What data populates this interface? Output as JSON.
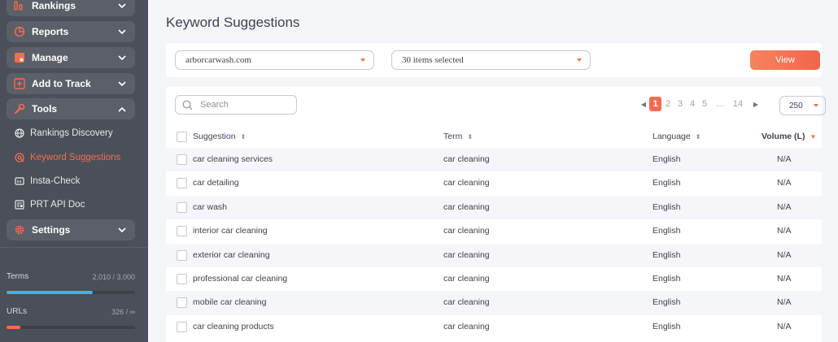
{
  "sidebar": {
    "nav": [
      {
        "label": "Rankings",
        "icon": "bar-chart-icon",
        "expanded": false
      },
      {
        "label": "Reports",
        "icon": "pie-chart-icon",
        "expanded": false
      },
      {
        "label": "Manage",
        "icon": "edit-icon",
        "expanded": false
      },
      {
        "label": "Add to Track",
        "icon": "plus-square-icon",
        "expanded": false
      },
      {
        "label": "Tools",
        "icon": "tools-icon",
        "expanded": true
      },
      {
        "label": "Settings",
        "icon": "gear-icon",
        "expanded": false
      }
    ],
    "tools_items": [
      {
        "label": "Rankings Discovery",
        "icon": "globe-icon",
        "active": false
      },
      {
        "label": "Keyword Suggestions",
        "icon": "target-icon",
        "active": true
      },
      {
        "label": "Insta-Check",
        "icon": "window-icon",
        "active": false
      },
      {
        "label": "PRT API Doc",
        "icon": "document-icon",
        "active": false
      }
    ],
    "stats": [
      {
        "name": "Terms",
        "value": "2,010 / 3,000",
        "fraction": 0.67,
        "color": "#3db4ec"
      },
      {
        "name": "URLs",
        "value": "326 / ∞",
        "fraction": 0.11,
        "color": "#f26e4f"
      }
    ]
  },
  "page": {
    "title": "Keyword Suggestions"
  },
  "filters": {
    "domain": "arborcarwash.com",
    "terms": "30 items selected",
    "view_label": "View"
  },
  "toolbar": {
    "search_placeholder": "Search",
    "pages": [
      "1",
      "2",
      "3",
      "4",
      "5",
      "...",
      "14"
    ],
    "current_page": "1",
    "per_page": "250"
  },
  "table": {
    "columns": {
      "suggestion": "Suggestion",
      "term": "Term",
      "language": "Language",
      "volume": "Volume (L)"
    },
    "rows": [
      {
        "suggestion": "car cleaning services",
        "term": "car cleaning",
        "language": "English",
        "volume": "N/A"
      },
      {
        "suggestion": "car detailing",
        "term": "car cleaning",
        "language": "English",
        "volume": "N/A"
      },
      {
        "suggestion": "car wash",
        "term": "car cleaning",
        "language": "English",
        "volume": "N/A"
      },
      {
        "suggestion": "interior car cleaning",
        "term": "car cleaning",
        "language": "English",
        "volume": "N/A"
      },
      {
        "suggestion": "exterior car cleaning",
        "term": "car cleaning",
        "language": "English",
        "volume": "N/A"
      },
      {
        "suggestion": "professional car cleaning",
        "term": "car cleaning",
        "language": "English",
        "volume": "N/A"
      },
      {
        "suggestion": "mobile car cleaning",
        "term": "car cleaning",
        "language": "English",
        "volume": "N/A"
      },
      {
        "suggestion": "car cleaning products",
        "term": "car cleaning",
        "language": "English",
        "volume": "N/A"
      }
    ]
  },
  "colors": {
    "accent": "#f26e4f",
    "sidebar": "#4a4f58",
    "progress_blue": "#3db4ec"
  }
}
